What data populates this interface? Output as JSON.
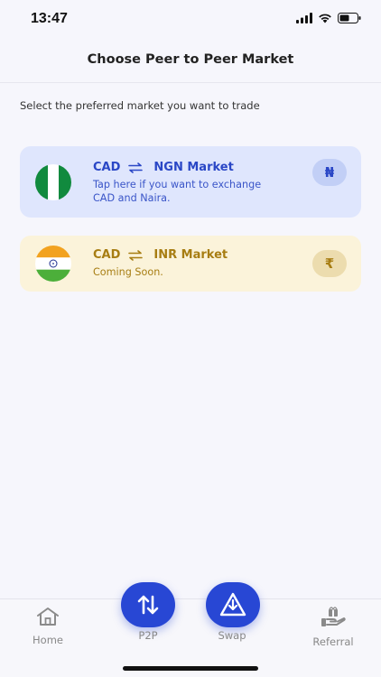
{
  "status_bar": {
    "time": "13:47"
  },
  "header": {
    "title": "Choose Peer to Peer Market"
  },
  "instruction": "Select the preferred market you want to trade",
  "markets": [
    {
      "from": "CAD",
      "to": "NGN Market",
      "description_line1": "Tap here if you want to exchange",
      "description_line2": "CAD and Naira.",
      "currency_symbol": "₦",
      "color": "#2a47c6",
      "background": "#dfe6fd"
    },
    {
      "from": "CAD",
      "to": "INR Market",
      "description_line1": "Coming Soon.",
      "currency_symbol": "₹",
      "color": "#a77d12",
      "background": "#fbf3da"
    }
  ],
  "bottom_nav": {
    "home": "Home",
    "p2p": "P2P",
    "swap": "Swap",
    "referral": "Referral"
  },
  "colors": {
    "accent": "#2847d4",
    "background": "#f6f6fc"
  }
}
